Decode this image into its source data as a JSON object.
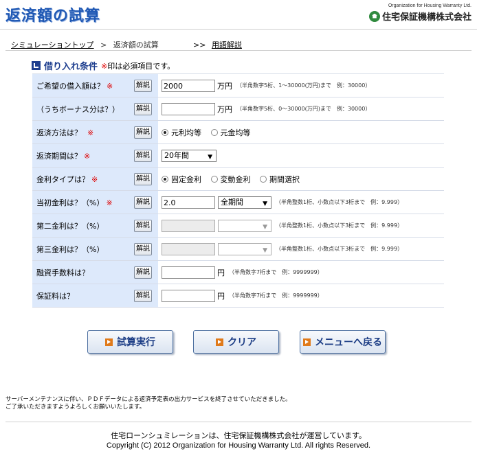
{
  "header": {
    "title": "返済額の試算",
    "org_en": "Organization for Housing Warranty Ltd.",
    "org_jp": "住宅保証機構株式会社"
  },
  "breadcrumb": {
    "home": "シミュレーショントップ",
    "separator": ">",
    "current": "返済額の試算",
    "terms_prefix": ">>",
    "terms": "用語解説"
  },
  "section": {
    "title": "借り入れ条件",
    "note_mark": "※",
    "note": "印は必須項目です。"
  },
  "explain_label": "解説",
  "rows": [
    {
      "label": "ご希望の借入額は？",
      "required": "※",
      "value": "2000",
      "unit": "万円",
      "hint": "（半角数字5桁、1～30000(万円)まで　例：30000）"
    },
    {
      "label": "（うちボーナス分は？）",
      "required": "",
      "value": "",
      "unit": "万円",
      "hint": "（半角数字5桁、0～30000(万円)まで　例：30000）"
    },
    {
      "label": "返済方法は？",
      "required": "※",
      "options": [
        "元利均等",
        "元金均等"
      ]
    },
    {
      "label": "返済期間は？",
      "required": "※",
      "select": "20年間"
    },
    {
      "label": "金利タイプは？",
      "required": "※",
      "options": [
        "固定金利",
        "変動金利",
        "期間選択"
      ]
    },
    {
      "label": "当初金利は？（%）",
      "required": "※",
      "value": "2.0",
      "select": "全期間",
      "hint": "（半角整数1桁、小数点以下3桁まで　例：9.999）"
    },
    {
      "label": "第二金利は？（%）",
      "required": "",
      "value": "",
      "select": "",
      "hint": "（半角整数1桁、小数点以下3桁まで　例：9.999）"
    },
    {
      "label": "第三金利は？（%）",
      "required": "",
      "value": "",
      "select": "",
      "hint": "（半角整数1桁、小数点以下3桁まで　例：9.999）"
    },
    {
      "label": "融資手数料は？",
      "required": "",
      "value": "",
      "unit": "円",
      "hint": "（半角数字7桁まで　例：9999999）"
    },
    {
      "label": "保証料は？",
      "required": "",
      "value": "",
      "unit": "円",
      "hint": "（半角数字7桁まで　例：9999999）"
    }
  ],
  "buttons": {
    "calculate": "試算実行",
    "clear": "クリア",
    "menu": "メニューへ戻る"
  },
  "notice": {
    "line1": "サーバーメンテナンスに伴い、ＰＤＦデータによる返済予定表の出力サービスを終了させていただきました。",
    "line2": "ご了承いただきますようよろしくお願いいたします。"
  },
  "footer": {
    "line1": "住宅ローンシュミレーションは、住宅保証機構株式会社が運営しています。",
    "copyright": "Copyright (C) 2012 Organization for Housing Warranty Ltd. All rights Reserved."
  }
}
